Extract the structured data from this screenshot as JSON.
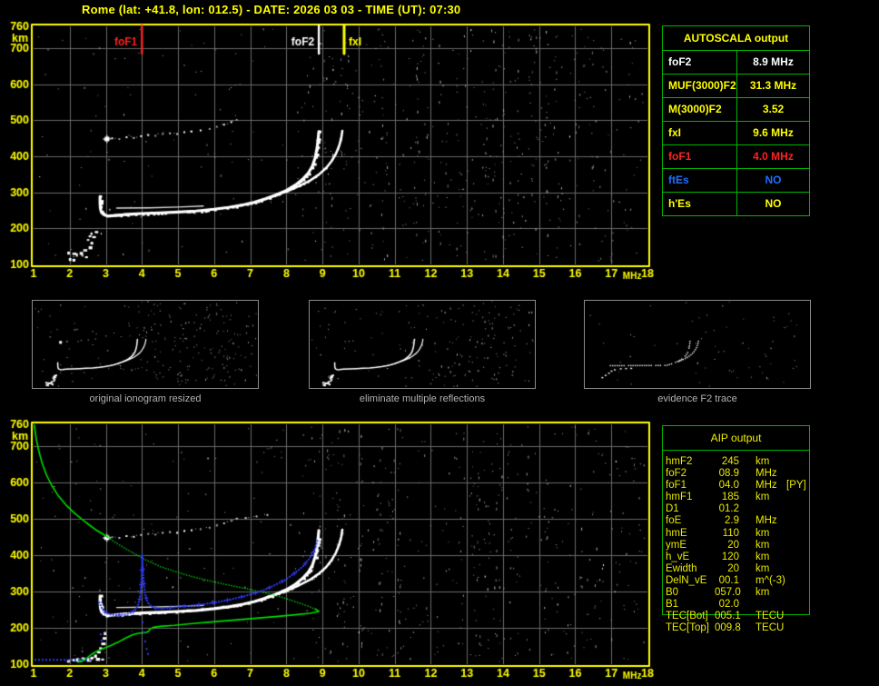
{
  "title": "Rome (lat: +41.8, lon: 012.5) - DATE: 2026 03 03 - TIME (UT): 07:30",
  "colors": {
    "background": "#000000",
    "yellow": "#ffff00",
    "panel_green": "#00b400",
    "grid": "#6a6a6a",
    "red": "#ff2222",
    "table_blue": "#1f6fff",
    "trace_white": "#ffffff",
    "profile_green": "#00dd00",
    "synth_blue": "#2d3bff",
    "caption_gray": "#b2b2b2",
    "aip_yellow": "#e9e900"
  },
  "autoscala": {
    "header": "AUTOSCALA output",
    "rows": [
      {
        "label": "foF2",
        "value": "8.9 MHz",
        "color": "#ffffff"
      },
      {
        "label": "MUF(3000)F2",
        "value": "31.3 MHz",
        "color": "#ffff00"
      },
      {
        "label": "M(3000)F2",
        "value": "3.52",
        "color": "#ffff00"
      },
      {
        "label": "fxI",
        "value": "9.6 MHz",
        "color": "#ffff00"
      },
      {
        "label": "foF1",
        "value": "4.0 MHz",
        "color": "#ff2222"
      },
      {
        "label": "ftEs",
        "value": "NO",
        "color": "#1f6fff"
      },
      {
        "label": "h'Es",
        "value": "NO",
        "color": "#ffff00"
      }
    ]
  },
  "aip": {
    "header": "AIP output",
    "rows": [
      {
        "label": "hmF2",
        "value": "245",
        "unit": "km",
        "extra": ""
      },
      {
        "label": "foF2",
        "value": "08.9",
        "unit": "MHz",
        "extra": ""
      },
      {
        "label": "foF1",
        "value": "04.0",
        "unit": "MHz",
        "extra": "[PY]"
      },
      {
        "label": "hmF1",
        "value": "185",
        "unit": "km",
        "extra": ""
      },
      {
        "label": "D1",
        "value": "01.2",
        "unit": "",
        "extra": ""
      },
      {
        "label": "foE",
        "value": "2.9",
        "unit": "MHz",
        "extra": ""
      },
      {
        "label": "hmE",
        "value": "110",
        "unit": "km",
        "extra": ""
      },
      {
        "label": "ymE",
        "value": "20",
        "unit": "km",
        "extra": ""
      },
      {
        "label": "h_vE",
        "value": "120",
        "unit": "km",
        "extra": ""
      },
      {
        "label": "Ewidth",
        "value": "20",
        "unit": "km",
        "extra": ""
      },
      {
        "label": "DelN_vE",
        "value": "00.1",
        "unit": "m^(-3)",
        "extra": ""
      },
      {
        "label": "B0",
        "value": "057.0",
        "unit": "km",
        "extra": ""
      },
      {
        "label": "B1",
        "value": "02.0",
        "unit": "",
        "extra": ""
      },
      {
        "label": "TEC[Bot]",
        "value": "005.1",
        "unit": "TECU",
        "extra": ""
      },
      {
        "label": "TEC[Top]",
        "value": "009.8",
        "unit": "TECU",
        "extra": ""
      }
    ]
  },
  "thumbnails": [
    {
      "caption": "original ionogram resized"
    },
    {
      "caption": "eliminate multiple reflections"
    },
    {
      "caption": "evidence F2 trace"
    }
  ],
  "chart_data": [
    {
      "type": "scatter",
      "title": "recorded ionogram with autoscaled characteristics",
      "xlabel": "MHz",
      "ylabel": "km",
      "x_range": [
        1,
        18
      ],
      "y_range": [
        100,
        760
      ],
      "x_ticks": [
        1,
        2,
        3,
        4,
        5,
        6,
        7,
        8,
        9,
        10,
        11,
        12,
        13,
        14,
        15,
        16,
        17,
        18
      ],
      "y_ticks": [
        760,
        700,
        600,
        500,
        400,
        300,
        200,
        100
      ],
      "grid": true,
      "markers": [
        {
          "label": "foF1",
          "f": 4.0,
          "color": "#ff2222"
        },
        {
          "label": "foF2",
          "f": 8.9,
          "color": "#ffffff"
        },
        {
          "label": "fxI",
          "f": 9.6,
          "color": "#ffff00"
        }
      ],
      "o_trace": [
        [
          2.84,
          288
        ],
        [
          2.84,
          270
        ],
        [
          2.85,
          255
        ],
        [
          2.88,
          244
        ],
        [
          2.95,
          238
        ],
        [
          3.05,
          234
        ],
        [
          3.2,
          235
        ],
        [
          3.5,
          238
        ],
        [
          4.0,
          241
        ],
        [
          4.5,
          243
        ],
        [
          5.0,
          245
        ],
        [
          5.5,
          248
        ],
        [
          6.0,
          253
        ],
        [
          6.4,
          258
        ],
        [
          6.8,
          265
        ],
        [
          7.1,
          272
        ],
        [
          7.4,
          281
        ],
        [
          7.7,
          292
        ],
        [
          8.0,
          305
        ],
        [
          8.25,
          320
        ],
        [
          8.45,
          336
        ],
        [
          8.6,
          352
        ],
        [
          8.72,
          372
        ],
        [
          8.8,
          396
        ],
        [
          8.85,
          422
        ],
        [
          8.88,
          448
        ],
        [
          8.9,
          468
        ]
      ],
      "x_trace": [
        [
          7.45,
          283
        ],
        [
          7.75,
          293
        ],
        [
          8.05,
          304
        ],
        [
          8.35,
          317
        ],
        [
          8.65,
          332
        ],
        [
          8.9,
          349
        ],
        [
          9.1,
          367
        ],
        [
          9.25,
          386
        ],
        [
          9.37,
          406
        ],
        [
          9.46,
          428
        ],
        [
          9.52,
          450
        ],
        [
          9.55,
          470
        ]
      ],
      "second_hop": [
        [
          2.95,
          448
        ],
        [
          3.15,
          452
        ],
        [
          3.35,
          450
        ],
        [
          3.55,
          455
        ],
        [
          3.75,
          453
        ],
        [
          3.95,
          458
        ],
        [
          4.15,
          461
        ],
        [
          4.35,
          459
        ],
        [
          4.55,
          464
        ],
        [
          4.75,
          466
        ],
        [
          4.95,
          464
        ],
        [
          5.15,
          469
        ],
        [
          5.35,
          471
        ],
        [
          5.6,
          474
        ],
        [
          5.85,
          478
        ],
        [
          6.05,
          484
        ],
        [
          6.25,
          490
        ],
        [
          6.45,
          497
        ],
        [
          6.6,
          503
        ]
      ],
      "star": [
        3.02,
        449
      ],
      "e_region": [
        [
          1.96,
          133
        ],
        [
          2.1,
          130
        ],
        [
          2.2,
          128
        ],
        [
          2.3,
          132
        ],
        [
          2.4,
          140
        ],
        [
          2.35,
          127
        ],
        [
          2.5,
          168
        ],
        [
          2.55,
          178
        ],
        [
          2.6,
          186
        ],
        [
          2.65,
          176
        ],
        [
          2.6,
          160
        ],
        [
          2.55,
          148
        ],
        [
          2.72,
          190
        ],
        [
          2.0,
          115
        ],
        [
          2.1,
          113
        ],
        [
          2.45,
          120
        ]
      ]
    },
    {
      "type": "scatter",
      "title": "ionogram with restored trace and electron density profile",
      "xlabel": "MHz",
      "ylabel": "km",
      "x_range": [
        1,
        18
      ],
      "y_range": [
        100,
        760
      ],
      "x_ticks": [
        1,
        2,
        3,
        4,
        5,
        6,
        7,
        8,
        9,
        10,
        11,
        12,
        13,
        14,
        15,
        16,
        17,
        18
      ],
      "y_ticks": [
        760,
        700,
        600,
        500,
        400,
        300,
        200,
        100
      ],
      "grid": true,
      "markers": [],
      "o_trace": [
        [
          2.84,
          288
        ],
        [
          2.84,
          270
        ],
        [
          2.85,
          255
        ],
        [
          2.88,
          244
        ],
        [
          2.95,
          238
        ],
        [
          3.05,
          234
        ],
        [
          3.2,
          235
        ],
        [
          3.5,
          238
        ],
        [
          4.0,
          241
        ],
        [
          4.5,
          243
        ],
        [
          5.0,
          245
        ],
        [
          5.5,
          248
        ],
        [
          6.0,
          253
        ],
        [
          6.4,
          258
        ],
        [
          6.8,
          265
        ],
        [
          7.1,
          272
        ],
        [
          7.4,
          281
        ],
        [
          7.7,
          292
        ],
        [
          8.0,
          305
        ],
        [
          8.25,
          320
        ],
        [
          8.45,
          336
        ],
        [
          8.6,
          352
        ],
        [
          8.72,
          372
        ],
        [
          8.8,
          396
        ],
        [
          8.85,
          422
        ],
        [
          8.88,
          448
        ],
        [
          8.9,
          468
        ]
      ],
      "x_trace": [
        [
          7.45,
          283
        ],
        [
          7.75,
          293
        ],
        [
          8.05,
          304
        ],
        [
          8.35,
          317
        ],
        [
          8.65,
          332
        ],
        [
          8.9,
          349
        ],
        [
          9.1,
          367
        ],
        [
          9.25,
          386
        ],
        [
          9.37,
          406
        ],
        [
          9.46,
          428
        ],
        [
          9.52,
          450
        ],
        [
          9.55,
          470
        ]
      ],
      "second_hop": [
        [
          2.95,
          448
        ],
        [
          3.15,
          452
        ],
        [
          3.35,
          450
        ],
        [
          3.55,
          455
        ],
        [
          3.75,
          453
        ],
        [
          3.95,
          458
        ],
        [
          4.15,
          461
        ],
        [
          4.35,
          459
        ],
        [
          4.55,
          464
        ],
        [
          4.75,
          466
        ],
        [
          4.95,
          464
        ],
        [
          5.15,
          469
        ],
        [
          5.35,
          471
        ],
        [
          5.6,
          474
        ],
        [
          5.85,
          478
        ],
        [
          6.05,
          484
        ],
        [
          6.25,
          490
        ],
        [
          6.45,
          497
        ],
        [
          6.6,
          503
        ],
        [
          6.85,
          505
        ],
        [
          7.15,
          509
        ],
        [
          7.45,
          513
        ]
      ],
      "star": [
        3.02,
        449
      ],
      "e_region": [
        [
          2.2,
          114
        ],
        [
          2.35,
          116
        ],
        [
          2.5,
          114
        ],
        [
          2.6,
          118
        ],
        [
          2.7,
          124
        ],
        [
          2.78,
          133
        ],
        [
          2.84,
          144
        ],
        [
          2.9,
          157
        ],
        [
          2.94,
          172
        ],
        [
          2.97,
          186
        ],
        [
          2.75,
          115
        ],
        [
          2.9,
          113
        ],
        [
          2.1,
          112
        ],
        [
          1.95,
          110
        ]
      ],
      "profile_green": [
        [
          1.02,
          758
        ],
        [
          1.07,
          722
        ],
        [
          1.14,
          688
        ],
        [
          1.24,
          652
        ],
        [
          1.36,
          620
        ],
        [
          1.5,
          592
        ],
        [
          1.68,
          564
        ],
        [
          1.9,
          538
        ],
        [
          2.15,
          514
        ],
        [
          2.45,
          490
        ],
        [
          2.75,
          468
        ],
        [
          3.05,
          450
        ],
        [
          3.35,
          430
        ],
        [
          3.7,
          410
        ],
        [
          4.1,
          388
        ],
        [
          4.5,
          370
        ],
        [
          4.95,
          355
        ],
        [
          5.4,
          342
        ],
        [
          5.9,
          330
        ],
        [
          6.4,
          319
        ],
        [
          6.9,
          309
        ],
        [
          7.4,
          298
        ],
        [
          7.85,
          286
        ],
        [
          8.25,
          273
        ],
        [
          8.6,
          261
        ],
        [
          8.8,
          252
        ],
        [
          8.9,
          245
        ],
        [
          8.65,
          240
        ],
        [
          8.25,
          236
        ],
        [
          7.7,
          231
        ],
        [
          7.1,
          226
        ],
        [
          6.5,
          221
        ],
        [
          5.9,
          216
        ],
        [
          5.4,
          212
        ],
        [
          4.9,
          207
        ],
        [
          4.5,
          204
        ],
        [
          4.3,
          201
        ],
        [
          4.22,
          196
        ],
        [
          4.18,
          190
        ],
        [
          4.1,
          187
        ],
        [
          3.9,
          185
        ],
        [
          3.75,
          181
        ],
        [
          3.55,
          172
        ],
        [
          3.35,
          161
        ],
        [
          3.15,
          152
        ],
        [
          2.95,
          144
        ],
        [
          2.78,
          137
        ],
        [
          2.65,
          130
        ],
        [
          2.55,
          123
        ],
        [
          2.47,
          116
        ],
        [
          2.4,
          111
        ],
        [
          2.32,
          107
        ],
        [
          2.22,
          106
        ],
        [
          2.3,
          110
        ]
      ],
      "profile_solid_until": 11,
      "profile_dotted_until": 25,
      "synth_blue": [
        [
          2.82,
          270
        ],
        [
          2.9,
          252
        ],
        [
          3.0,
          241
        ],
        [
          3.15,
          236
        ],
        [
          3.35,
          235
        ],
        [
          3.55,
          237
        ],
        [
          3.72,
          242
        ],
        [
          3.82,
          250
        ],
        [
          3.89,
          262
        ],
        [
          3.94,
          280
        ],
        [
          3.97,
          305
        ],
        [
          3.99,
          335
        ],
        [
          4.0,
          368
        ],
        [
          4.01,
          400
        ],
        [
          4.03,
          352
        ],
        [
          4.06,
          315
        ],
        [
          4.1,
          288
        ],
        [
          4.16,
          270
        ],
        [
          4.25,
          259
        ],
        [
          4.4,
          254
        ],
        [
          4.65,
          254
        ],
        [
          4.95,
          257
        ],
        [
          5.25,
          260
        ],
        [
          5.55,
          263
        ],
        [
          5.85,
          267
        ],
        [
          6.15,
          272
        ],
        [
          6.45,
          278
        ],
        [
          6.75,
          285
        ],
        [
          7.05,
          293
        ],
        [
          7.35,
          303
        ],
        [
          7.65,
          316
        ],
        [
          7.95,
          331
        ],
        [
          8.2,
          348
        ],
        [
          8.45,
          368
        ],
        [
          8.62,
          388
        ],
        [
          8.75,
          408
        ],
        [
          8.83,
          428
        ],
        [
          8.87,
          445
        ]
      ],
      "synth_blue_e": [
        [
          1.05,
          112
        ],
        [
          2.6,
          112
        ]
      ],
      "synth_blue_spike_down": [
        [
          4.02,
          215
        ],
        [
          4.05,
          188
        ],
        [
          4.09,
          163
        ],
        [
          4.13,
          142
        ],
        [
          4.17,
          128
        ],
        [
          2.86,
          182
        ],
        [
          2.88,
          165
        ]
      ]
    }
  ]
}
